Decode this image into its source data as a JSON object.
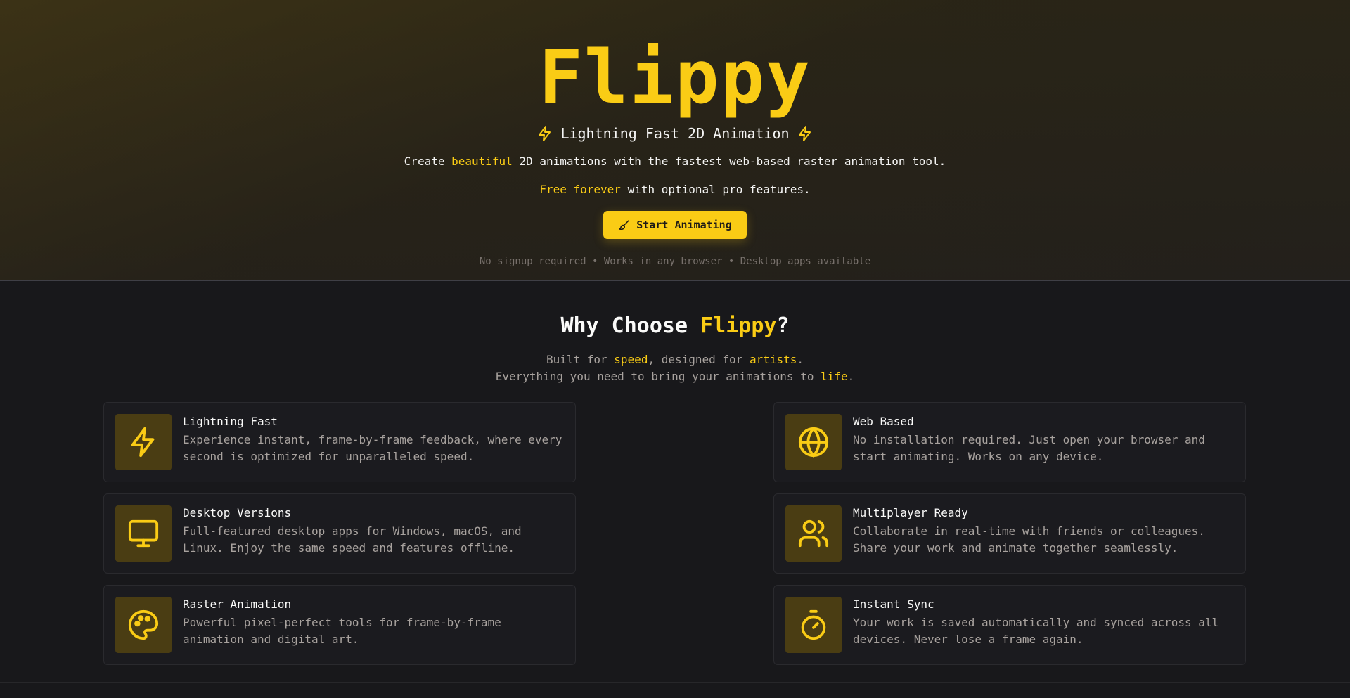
{
  "hero": {
    "title": "Flippy",
    "tagline": "Lightning Fast 2D Animation",
    "line1_pre": "Create ",
    "line1_hl": "beautiful",
    "line1_post": " 2D animations with the fastest web-based raster animation tool.",
    "line2_hl": "Free forever",
    "line2_post": " with optional pro features.",
    "cta_label": "Start Animating",
    "note": "No signup required • Works in any browser • Desktop apps available"
  },
  "features": {
    "title_pre": "Why Choose ",
    "title_hl": "Flippy",
    "title_post": "?",
    "sub1_a": "Built for ",
    "sub1_b": "speed",
    "sub1_c": ", designed for ",
    "sub1_d": "artists",
    "sub1_e": ".",
    "sub2_a": "Everything you need to bring your animations to ",
    "sub2_b": "life",
    "sub2_c": ".",
    "cards": [
      {
        "icon": "lightning-icon",
        "title": "Lightning Fast",
        "desc": "Experience instant, frame-by-frame feedback, where every second is optimized for unparalleled speed."
      },
      {
        "icon": "globe-icon",
        "title": "Web Based",
        "desc": "No installation required. Just open your browser and start animating. Works on any device."
      },
      {
        "icon": "monitor-icon",
        "title": "Desktop Versions",
        "desc": "Full-featured desktop apps for Windows, macOS, and Linux. Enjoy the same speed and features offline."
      },
      {
        "icon": "users-icon",
        "title": "Multiplayer Ready",
        "desc": "Collaborate in real-time with friends or colleagues. Share your work and animate together seamlessly."
      },
      {
        "icon": "palette-icon",
        "title": "Raster Animation",
        "desc": "Powerful pixel-perfect tools for frame-by-frame animation and digital art."
      },
      {
        "icon": "stopwatch-icon",
        "title": "Instant Sync",
        "desc": "Your work is saved automatically and synced across all devices. Never lose a frame again."
      }
    ]
  },
  "colors": {
    "accent": "#facc15",
    "background": "#18181b",
    "icon_box": "#4a3d13"
  }
}
